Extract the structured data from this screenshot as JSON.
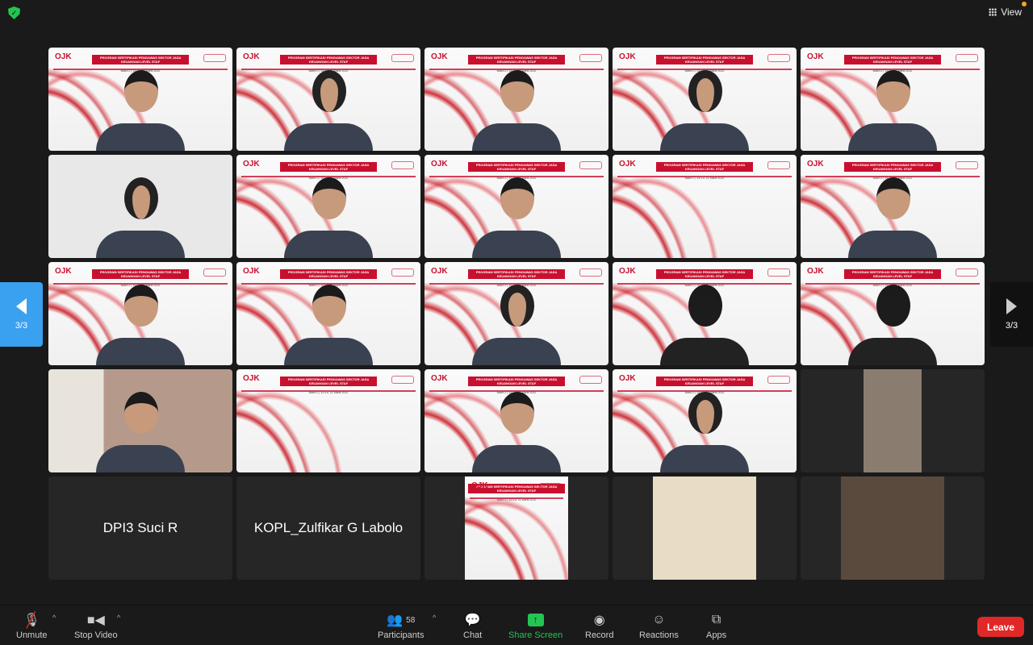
{
  "top": {
    "security_icon": "shield-check-icon",
    "view_label": "View",
    "view_icon": "grid-icon"
  },
  "slide": {
    "title": "PROGRAM SERTIFIKASI PENGAWAS SEKTOR JASA KEUANGAN LEVEL STAF",
    "batch": "Batch 2 | 14 s.d. 21 Maret 2022",
    "logo": "OJK"
  },
  "tiles": [
    {
      "type": "slide",
      "person": "normal"
    },
    {
      "type": "slide",
      "person": "hij"
    },
    {
      "type": "slide",
      "person": "normal"
    },
    {
      "type": "slide",
      "person": "hij"
    },
    {
      "type": "slide",
      "person": "normal"
    },
    {
      "type": "plain",
      "person": "hij"
    },
    {
      "type": "slide",
      "person": "normal"
    },
    {
      "type": "slide",
      "person": "normal"
    },
    {
      "type": "slide",
      "person": ""
    },
    {
      "type": "slide",
      "person": "normal"
    },
    {
      "type": "slide",
      "person": "normal"
    },
    {
      "type": "slide",
      "person": "normal"
    },
    {
      "type": "slide",
      "person": "hij"
    },
    {
      "type": "slide",
      "person": "dark"
    },
    {
      "type": "slide",
      "person": "dark"
    },
    {
      "type": "room",
      "person": "normal"
    },
    {
      "type": "slide",
      "person": ""
    },
    {
      "type": "slide",
      "person": "normal"
    },
    {
      "type": "slide",
      "person": "hij"
    },
    {
      "type": "portrait",
      "color": "#8a7d70"
    },
    {
      "type": "name",
      "name": "DPI3 Suci R"
    },
    {
      "type": "name",
      "name": "KOPL_Zulfikar G Labolo"
    },
    {
      "type": "narrow-slide"
    },
    {
      "type": "portrait",
      "color": "#e8dcc4",
      "wide": true
    },
    {
      "type": "portrait",
      "color": "#5a4a3e",
      "wide": true
    }
  ],
  "nav": {
    "left_page": "3/3",
    "right_page": "3/3"
  },
  "toolbar": {
    "unmute": "Unmute",
    "stop_video": "Stop Video",
    "participants": "Participants",
    "participants_count": "58",
    "chat": "Chat",
    "share_screen": "Share Screen",
    "record": "Record",
    "reactions": "Reactions",
    "apps": "Apps",
    "leave": "Leave"
  }
}
